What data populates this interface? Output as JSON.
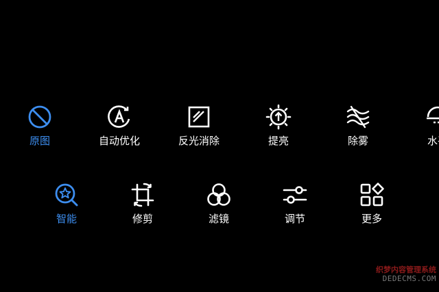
{
  "colors": {
    "background": "#000000",
    "active": "#3d8ef0",
    "inactive": "#ffffff"
  },
  "row1": [
    {
      "label": "原图",
      "icon": "ban-circle-icon",
      "active": true
    },
    {
      "label": "自动优化",
      "icon": "auto-enhance-icon",
      "active": false
    },
    {
      "label": "反光消除",
      "icon": "glare-remove-icon",
      "active": false
    },
    {
      "label": "提亮",
      "icon": "brighten-icon",
      "active": false
    },
    {
      "label": "除雾",
      "icon": "dehaze-icon",
      "active": false
    },
    {
      "label": "水平",
      "icon": "level-icon",
      "active": false
    }
  ],
  "row2": [
    {
      "label": "智能",
      "icon": "smart-search-icon",
      "active": true
    },
    {
      "label": "修剪",
      "icon": "crop-rotate-icon",
      "active": false
    },
    {
      "label": "滤镜",
      "icon": "filter-circles-icon",
      "active": false
    },
    {
      "label": "调节",
      "icon": "sliders-icon",
      "active": false
    },
    {
      "label": "更多",
      "icon": "more-grid-icon",
      "active": false
    }
  ],
  "watermark": {
    "line1": "织梦内容管理系统",
    "line2": "DEDECMS.COM"
  }
}
